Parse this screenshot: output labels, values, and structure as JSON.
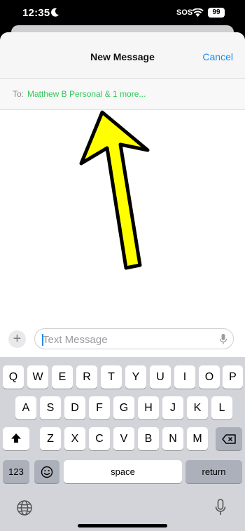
{
  "status_bar": {
    "time": "12:35",
    "carrier_status": "SOS",
    "battery": "99"
  },
  "nav": {
    "title": "New Message",
    "cancel_label": "Cancel"
  },
  "recipients": {
    "to_label": "To:",
    "value": "Matthew B Personal & 1 more..."
  },
  "compose": {
    "plus_label": "+",
    "placeholder": "Text Message"
  },
  "keyboard": {
    "row1": [
      "Q",
      "W",
      "E",
      "R",
      "T",
      "Y",
      "U",
      "I",
      "O",
      "P"
    ],
    "row2": [
      "A",
      "S",
      "D",
      "F",
      "G",
      "H",
      "J",
      "K",
      "L"
    ],
    "row3": [
      "Z",
      "X",
      "C",
      "V",
      "B",
      "N",
      "M"
    ],
    "numbers_label": "123",
    "space_label": "space",
    "return_label": "return"
  },
  "colors": {
    "accent_blue": "#1a8bf0",
    "recipient_green": "#33c759",
    "arrow_yellow": "#ffff00"
  },
  "icons": [
    "moon-icon",
    "wifi-icon",
    "shift-icon",
    "backspace-icon",
    "emoji-icon",
    "globe-icon",
    "microphone-icon",
    "annotation-arrow"
  ]
}
